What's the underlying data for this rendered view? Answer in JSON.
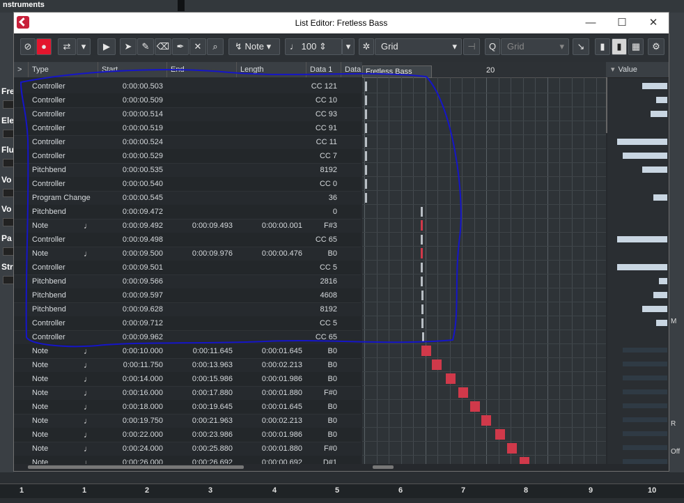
{
  "background": {
    "top_label": "nstruments",
    "side_labels": [
      "Fre",
      "Ele",
      "Flu",
      "Vo",
      "Vo",
      "Pa",
      "Str"
    ],
    "ruler_numbers": [
      "1",
      "1",
      "2",
      "3",
      "4",
      "5",
      "6",
      "7",
      "8",
      "9",
      "10"
    ],
    "right_labels": [
      "M",
      "R",
      "Off"
    ]
  },
  "window": {
    "title": "List Editor: Fretless Bass",
    "minimize": "—",
    "maximize": "☐",
    "close": "✕"
  },
  "toolbar": {
    "type_select": "Note",
    "velocity": "100",
    "snap_mode": "Grid",
    "quantize": "Grid"
  },
  "columns": {
    "expand": ">",
    "type": "Type",
    "start": "Start",
    "end": "End",
    "length": "Length",
    "data1": "Data 1",
    "data2": "Data",
    "value": "Value"
  },
  "graph": {
    "part_label": "Fretless Bass",
    "bar_number": "20"
  },
  "events": [
    {
      "type": "Controller",
      "note": false,
      "start": "0:00:00.503",
      "end": "",
      "length": "",
      "data1": "CC 121"
    },
    {
      "type": "Controller",
      "note": false,
      "start": "0:00:00.509",
      "end": "",
      "length": "",
      "data1": "CC 10"
    },
    {
      "type": "Controller",
      "note": false,
      "start": "0:00:00.514",
      "end": "",
      "length": "",
      "data1": "CC 93"
    },
    {
      "type": "Controller",
      "note": false,
      "start": "0:00:00.519",
      "end": "",
      "length": "",
      "data1": "CC 91"
    },
    {
      "type": "Controller",
      "note": false,
      "start": "0:00:00.524",
      "end": "",
      "length": "",
      "data1": "CC 11"
    },
    {
      "type": "Controller",
      "note": false,
      "start": "0:00:00.529",
      "end": "",
      "length": "",
      "data1": "CC 7"
    },
    {
      "type": "Pitchbend",
      "note": false,
      "start": "0:00:00.535",
      "end": "",
      "length": "",
      "data1": "8192"
    },
    {
      "type": "Controller",
      "note": false,
      "start": "0:00:00.540",
      "end": "",
      "length": "",
      "data1": "CC 0"
    },
    {
      "type": "Program Change",
      "note": false,
      "start": "0:00:00.545",
      "end": "",
      "length": "",
      "data1": "36"
    },
    {
      "type": "Pitchbend",
      "note": false,
      "start": "0:00:09.472",
      "end": "",
      "length": "",
      "data1": "0"
    },
    {
      "type": "Note",
      "note": true,
      "start": "0:00:09.492",
      "end": "0:00:09.493",
      "length": "0:00:00.001",
      "data1": "F#3"
    },
    {
      "type": "Controller",
      "note": false,
      "start": "0:00:09.498",
      "end": "",
      "length": "",
      "data1": "CC 65"
    },
    {
      "type": "Note",
      "note": true,
      "start": "0:00:09.500",
      "end": "0:00:09.976",
      "length": "0:00:00.476",
      "data1": "B0"
    },
    {
      "type": "Controller",
      "note": false,
      "start": "0:00:09.501",
      "end": "",
      "length": "",
      "data1": "CC 5"
    },
    {
      "type": "Pitchbend",
      "note": false,
      "start": "0:00:09.566",
      "end": "",
      "length": "",
      "data1": "2816"
    },
    {
      "type": "Pitchbend",
      "note": false,
      "start": "0:00:09.597",
      "end": "",
      "length": "",
      "data1": "4608"
    },
    {
      "type": "Pitchbend",
      "note": false,
      "start": "0:00:09.628",
      "end": "",
      "length": "",
      "data1": "8192"
    },
    {
      "type": "Controller",
      "note": false,
      "start": "0:00:09.712",
      "end": "",
      "length": "",
      "data1": "CC 5"
    },
    {
      "type": "Controller",
      "note": false,
      "start": "0:00:09.962",
      "end": "",
      "length": "",
      "data1": "CC 65"
    },
    {
      "type": "Note",
      "note": true,
      "start": "0:00:10.000",
      "end": "0:00:11.645",
      "length": "0:00:01.645",
      "data1": "B0"
    },
    {
      "type": "Note",
      "note": true,
      "start": "0:00:11.750",
      "end": "0:00:13.963",
      "length": "0:00:02.213",
      "data1": "B0"
    },
    {
      "type": "Note",
      "note": true,
      "start": "0:00:14.000",
      "end": "0:00:15.986",
      "length": "0:00:01.986",
      "data1": "B0"
    },
    {
      "type": "Note",
      "note": true,
      "start": "0:00:16.000",
      "end": "0:00:17.880",
      "length": "0:00:01.880",
      "data1": "F#0"
    },
    {
      "type": "Note",
      "note": true,
      "start": "0:00:18.000",
      "end": "0:00:19.645",
      "length": "0:00:01.645",
      "data1": "B0"
    },
    {
      "type": "Note",
      "note": true,
      "start": "0:00:19.750",
      "end": "0:00:21.963",
      "length": "0:00:02.213",
      "data1": "B0"
    },
    {
      "type": "Note",
      "note": true,
      "start": "0:00:22.000",
      "end": "0:00:23.986",
      "length": "0:00:01.986",
      "data1": "B0"
    },
    {
      "type": "Note",
      "note": true,
      "start": "0:00:24.000",
      "end": "0:00:25.880",
      "length": "0:00:01.880",
      "data1": "F#0"
    },
    {
      "type": "Note",
      "note": true,
      "start": "0:00:26.000",
      "end": "0:00:26.692",
      "length": "0:00:00.692",
      "data1": "D#1"
    }
  ],
  "value_levels": [
    0.45,
    0.2,
    0.3,
    0,
    0.9,
    0.8,
    0.45,
    0,
    0.25,
    0,
    0,
    0.9,
    0,
    0.9,
    0.15,
    0.25,
    0.45,
    0.2,
    0
  ],
  "colors": {
    "accent_red": "#e3152d",
    "note_block": "#d0394a",
    "annotation_blue": "#1515c8",
    "value_bar": "#c9d6e2"
  }
}
